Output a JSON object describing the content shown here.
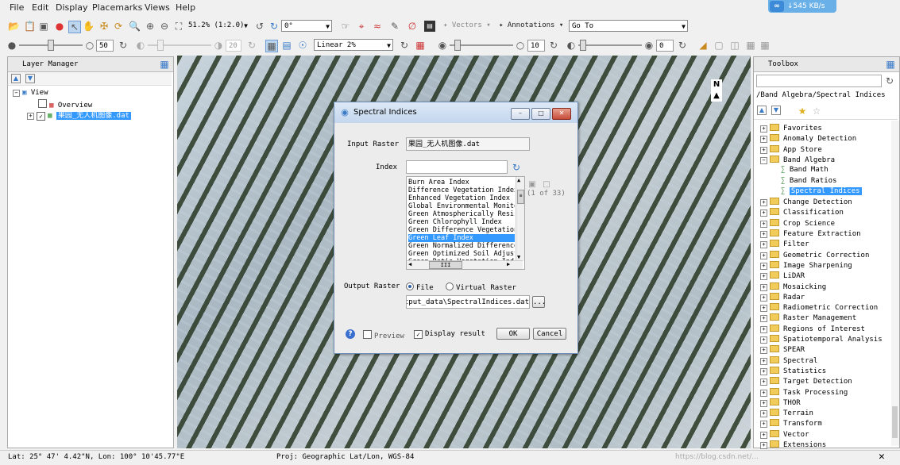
{
  "menu": [
    "File",
    "Edit",
    "Display",
    "Placemarks",
    "Views",
    "Help"
  ],
  "net_badge": "↓545 KB/s",
  "toolbar1": {
    "zoom": "51.2% (1:2.0)",
    "rotation": "0°",
    "vectors_label": "Vectors",
    "annotations_label": "Annotations",
    "goto_label": "Go To"
  },
  "toolbar2": {
    "brightness": "50",
    "contrast": "20",
    "stretch": "Linear 2%",
    "sharpen": "10",
    "transparency": "0"
  },
  "layer_manager": {
    "title": "Layer Manager",
    "view": "View",
    "overview": "Overview",
    "layer": "果园_无人机图像.dat"
  },
  "toolbox": {
    "title": "Toolbox",
    "search_value": "",
    "path": "/Band Algebra/Spectral Indices",
    "items": [
      {
        "label": "Favorites",
        "level": 0,
        "kind": "folder"
      },
      {
        "label": "Anomaly Detection",
        "level": 0,
        "kind": "folder"
      },
      {
        "label": "App Store",
        "level": 0,
        "kind": "folder"
      },
      {
        "label": "Band Algebra",
        "level": 0,
        "kind": "folder-open"
      },
      {
        "label": "Band Math",
        "level": 1,
        "kind": "tool"
      },
      {
        "label": "Band Ratios",
        "level": 1,
        "kind": "tool"
      },
      {
        "label": "Spectral Indices",
        "level": 1,
        "kind": "tool-selected"
      },
      {
        "label": "Change Detection",
        "level": 0,
        "kind": "folder"
      },
      {
        "label": "Classification",
        "level": 0,
        "kind": "folder"
      },
      {
        "label": "Crop Science",
        "level": 0,
        "kind": "folder"
      },
      {
        "label": "Feature Extraction",
        "level": 0,
        "kind": "folder"
      },
      {
        "label": "Filter",
        "level": 0,
        "kind": "folder"
      },
      {
        "label": "Geometric Correction",
        "level": 0,
        "kind": "folder"
      },
      {
        "label": "Image Sharpening",
        "level": 0,
        "kind": "folder"
      },
      {
        "label": "LiDAR",
        "level": 0,
        "kind": "folder"
      },
      {
        "label": "Mosaicking",
        "level": 0,
        "kind": "folder"
      },
      {
        "label": "Radar",
        "level": 0,
        "kind": "folder"
      },
      {
        "label": "Radiometric Correction",
        "level": 0,
        "kind": "folder"
      },
      {
        "label": "Raster Management",
        "level": 0,
        "kind": "folder"
      },
      {
        "label": "Regions of Interest",
        "level": 0,
        "kind": "folder"
      },
      {
        "label": "Spatiotemporal Analysis",
        "level": 0,
        "kind": "folder"
      },
      {
        "label": "SPEAR",
        "level": 0,
        "kind": "folder"
      },
      {
        "label": "Spectral",
        "level": 0,
        "kind": "folder"
      },
      {
        "label": "Statistics",
        "level": 0,
        "kind": "folder"
      },
      {
        "label": "Target Detection",
        "level": 0,
        "kind": "folder"
      },
      {
        "label": "Task Processing",
        "level": 0,
        "kind": "folder"
      },
      {
        "label": "THOR",
        "level": 0,
        "kind": "folder"
      },
      {
        "label": "Terrain",
        "level": 0,
        "kind": "folder"
      },
      {
        "label": "Transform",
        "level": 0,
        "kind": "folder"
      },
      {
        "label": "Vector",
        "level": 0,
        "kind": "folder"
      },
      {
        "label": "Extensions",
        "level": 0,
        "kind": "folder"
      }
    ]
  },
  "north_label": "N",
  "dialog": {
    "title": "Spectral Indices",
    "input_raster_label": "Input Raster",
    "input_raster_value": "果园_无人机图像.dat",
    "index_label": "Index",
    "index_value": "",
    "count_label": "(1 of 33)",
    "index_items": [
      "Burn Area Index",
      "Difference Vegetation Index",
      "Enhanced Vegetation Index",
      "Global Environmental Monitoring Index",
      "Green Atmospherically Resistant Index",
      "Green Chlorophyll Index",
      "Green Difference Vegetation Index",
      "Green Leaf Index",
      "Green Normalized Difference Vegetation Index",
      "Green Optimized Soil Adjusted Vegetation Index",
      "Green Ratio Vegetation Index"
    ],
    "selected_index": 7,
    "scroll_thumb_label": "III",
    "output_raster_label": "Output Raster",
    "file_label": "File",
    "virtual_raster_label": "Virtual Raster",
    "output_path": "output_data\\SpectralIndices.dat",
    "browse_label": "...",
    "preview_label": "Preview",
    "display_result_label": "Display result",
    "ok_label": "OK",
    "cancel_label": "Cancel"
  },
  "status": {
    "latlon": "Lat: 25° 47' 4.42\"N, Lon: 100° 10'45.77\"E",
    "proj": "Proj: Geographic Lat/Lon, WGS-84",
    "watermark": "https://blog.csdn.net/..."
  }
}
